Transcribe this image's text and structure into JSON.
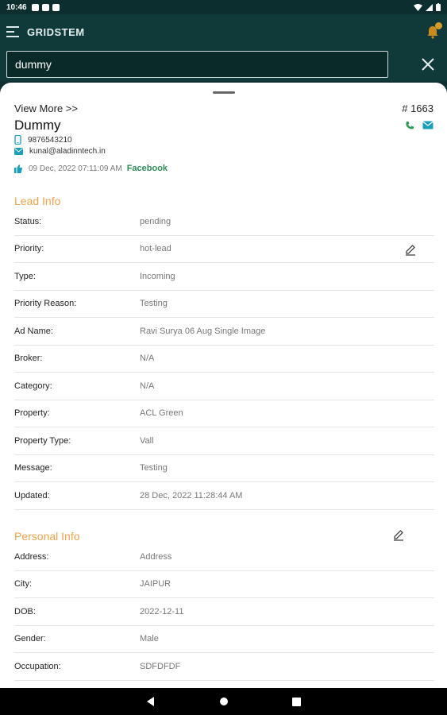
{
  "status_bar": {
    "time": "10:46"
  },
  "app_bar": {
    "title": "GRIDSTEM"
  },
  "search": {
    "value": "dummy"
  },
  "lead": {
    "view_more": "View More >>",
    "id": "# 1663",
    "name": "Dummy",
    "phone": "9876543210",
    "email": "kunal@aladinntech.in",
    "created": "09 Dec, 2022 07:11:09 AM",
    "source": "Facebook"
  },
  "lead_info": {
    "title": "Lead Info",
    "rows": [
      {
        "label": "Status:",
        "value": "pending"
      },
      {
        "label": "Priority:",
        "value": "hot-lead"
      },
      {
        "label": "Type:",
        "value": "Incoming"
      },
      {
        "label": "Priority Reason:",
        "value": "Testing"
      },
      {
        "label": "Ad Name:",
        "value": "Ravi Surya 06 Aug Single Image"
      },
      {
        "label": "Broker:",
        "value": "N/A"
      },
      {
        "label": "Category:",
        "value": "N/A"
      },
      {
        "label": "Property:",
        "value": "ACL Green"
      },
      {
        "label": "Property Type:",
        "value": "Vall"
      },
      {
        "label": "Message:",
        "value": "Testing"
      },
      {
        "label": "Updated:",
        "value": "28 Dec, 2022 11:28:44 AM"
      }
    ]
  },
  "personal_info": {
    "title": "Personal Info",
    "rows": [
      {
        "label": "Address:",
        "value": "Address"
      },
      {
        "label": "City:",
        "value": "JAIPUR"
      },
      {
        "label": "DOB:",
        "value": "2022-12-11"
      },
      {
        "label": "Gender:",
        "value": "Male"
      },
      {
        "label": "Occupation:",
        "value": "SDFDFDF"
      }
    ]
  },
  "colors": {
    "primary": "#103a3a",
    "accent": "#f0a24a",
    "source": "#2e8b57",
    "icon": "#1aa0b8"
  },
  "icons": [
    "menu-icon",
    "bell-icon",
    "close-icon",
    "phone-icon",
    "email-icon",
    "call-icon",
    "message-icon",
    "thumb-icon",
    "edit-icon",
    "nav-back-icon",
    "nav-home-icon",
    "nav-recents-icon"
  ]
}
